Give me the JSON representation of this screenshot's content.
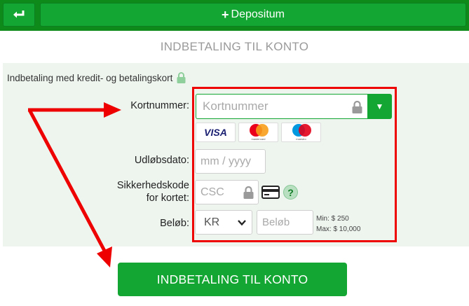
{
  "header": {
    "back_icon": "return-arrow-icon",
    "deposit_icon": "plus-icon",
    "deposit_label": "Depositum"
  },
  "page": {
    "title": "INDBETALING TIL KONTO",
    "payment_method": "Indbetaling med kredit- og betalingskort",
    "payment_method_icon": "lock-icon"
  },
  "form": {
    "card_number_label": "Kortnummer:",
    "card_number_placeholder": "Kortnummer",
    "card_logos": [
      "VISA",
      "mastercard",
      "maestro"
    ],
    "expiry_label": "Udløbsdato:",
    "expiry_placeholder": "mm / yyyy",
    "csc_label_line1": "Sikkerhedskode",
    "csc_label_line2": "for kortet:",
    "csc_placeholder": "CSC",
    "help_symbol": "?",
    "amount_label": "Beløb:",
    "currency_value": "KR",
    "amount_placeholder": "Beløb",
    "min_text": "Min: $ 250",
    "max_text": "Max: $ 10,000"
  },
  "submit_label": "INDBETALING TIL KONTO",
  "colors": {
    "brand_green": "#14a632",
    "topbar_green": "#0e8a1b",
    "highlight_red": "#ee0000",
    "panel_bg": "#eef5ef"
  }
}
